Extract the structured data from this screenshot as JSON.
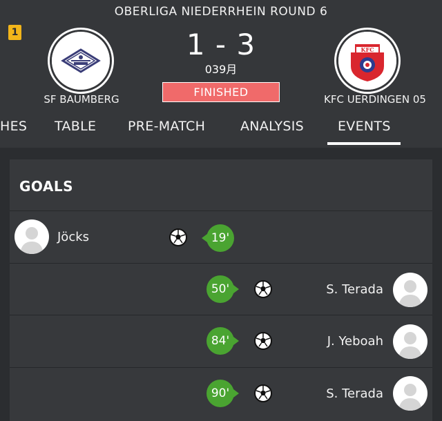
{
  "header": {
    "round_title": "OBERLIGA  NIEDERRHEIN ROUND 6",
    "corner_badge": "1",
    "home_team": "SF BAUMBERG",
    "away_team": "KFC UERDINGEN 05",
    "score": "1 - 3",
    "score_sub": "039月",
    "status": "FINISHED",
    "away_crest_text": "KFC"
  },
  "tabs": [
    {
      "label": "HES"
    },
    {
      "label": "TABLE"
    },
    {
      "label": "PRE-MATCH"
    },
    {
      "label": "ANALYSIS"
    },
    {
      "label": "EVENTS",
      "active": true
    }
  ],
  "goals": {
    "title": "GOALS",
    "events": [
      {
        "player": "Jöcks",
        "minute": "19'",
        "side": "home"
      },
      {
        "player": "S. Terada",
        "minute": "50'",
        "side": "away"
      },
      {
        "player": "J. Yeboah",
        "minute": "84'",
        "side": "away"
      },
      {
        "player": "S. Terada",
        "minute": "90'",
        "side": "away"
      }
    ]
  },
  "colors": {
    "background": "#2b2d30",
    "header": "#35373a",
    "card": "#37393c",
    "finished": "#f06a6a",
    "goal_minute": "#4aa431",
    "badge": "#f2b51a"
  }
}
